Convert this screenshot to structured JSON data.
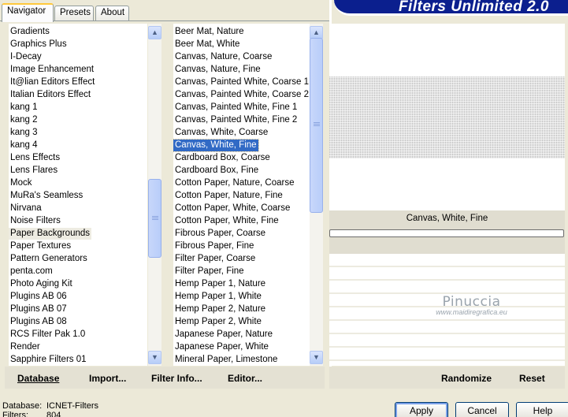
{
  "tabs": [
    "Navigator",
    "Presets",
    "About"
  ],
  "banner": {
    "title": "Filters Unlimited 2.0"
  },
  "categories": {
    "items": [
      "Gradients",
      "Graphics Plus",
      "I-Decay",
      "Image Enhancement",
      "It@lian Editors Effect",
      "Italian Editors Effect",
      "kang 1",
      "kang 2",
      "kang 3",
      "kang 4",
      "Lens Effects",
      "Lens Flares",
      "Mock",
      "MuRa's Seamless",
      "Nirvana",
      "Noise Filters",
      "Paper Backgrounds",
      "Paper Textures",
      "Pattern Generators",
      "penta.com",
      "Photo Aging Kit",
      "Plugins AB 06",
      "Plugins AB 07",
      "Plugins AB 08",
      "RCS Filter Pak 1.0",
      "Render",
      "Sapphire Filters 01"
    ],
    "selected_index": 16,
    "scroll_position": 0.6
  },
  "filters": {
    "items": [
      "Beer Mat, Nature",
      "Beer Mat, White",
      "Canvas, Nature, Coarse",
      "Canvas, Nature, Fine",
      "Canvas, Painted White, Coarse 1",
      "Canvas, Painted White, Coarse 2",
      "Canvas, Painted White, Fine 1",
      "Canvas, Painted White, Fine 2",
      "Canvas, White, Coarse",
      "Canvas, White, Fine",
      "Cardboard Box, Coarse",
      "Cardboard Box, Fine",
      "Cotton Paper, Nature, Coarse",
      "Cotton Paper, Nature, Fine",
      "Cotton Paper, White, Coarse",
      "Cotton Paper, White, Fine",
      "Fibrous Paper, Coarse",
      "Fibrous Paper, Fine",
      "Filter Paper, Coarse",
      "Filter Paper, Fine",
      "Hemp Paper 1, Nature",
      "Hemp Paper 1, White",
      "Hemp Paper 2, Nature",
      "Hemp Paper 2, White",
      "Japanese Paper, Nature",
      "Japanese Paper, White",
      "Mineral Paper, Limestone"
    ],
    "selected_index": 9,
    "scroll_position": 0.0
  },
  "preview": {
    "filter_name": "Canvas, White, Fine",
    "progress": 0
  },
  "watermark": {
    "name": "Pinuccia",
    "url": "www.maidiregrafica.eu"
  },
  "links": {
    "database": "Database",
    "import": "Import...",
    "filter_info": "Filter Info...",
    "editor": "Editor...",
    "randomize": "Randomize",
    "reset": "Reset"
  },
  "status": {
    "database_label": "Database:",
    "database_value": "ICNET-Filters",
    "filters_label": "Filters:",
    "filters_value": "804"
  },
  "buttons": {
    "apply": "Apply",
    "cancel": "Cancel",
    "help": "Help"
  },
  "colors": {
    "banner": "#0b1f8e",
    "selection": "#316ac5",
    "face": "#ece9d8"
  }
}
